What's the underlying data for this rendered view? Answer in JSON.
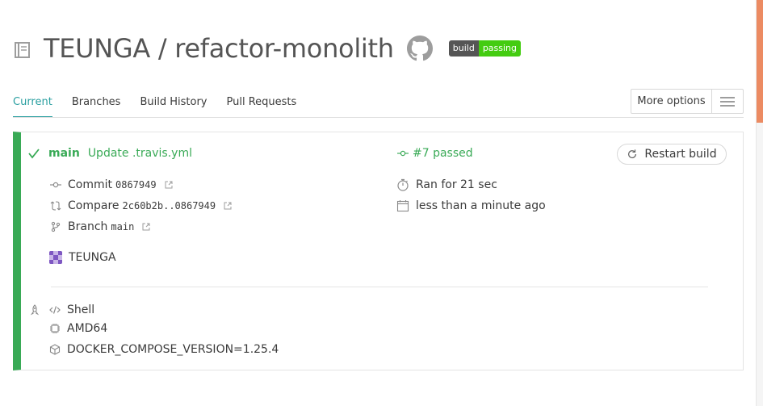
{
  "header": {
    "repo_title": "TEUNGA / refactor-monolith",
    "badge_left": "build",
    "badge_right": "passing"
  },
  "tabs": [
    {
      "label": "Current",
      "active": true
    },
    {
      "label": "Branches",
      "active": false
    },
    {
      "label": "Build History",
      "active": false
    },
    {
      "label": "Pull Requests",
      "active": false
    }
  ],
  "more_options": {
    "label": "More options"
  },
  "build": {
    "branch": "main",
    "commit_message": "Update .travis.yml",
    "status": "#7 passed",
    "restart_label": "Restart build",
    "commit_label": "Commit",
    "commit_sha": "0867949",
    "compare_label": "Compare",
    "compare_range": "2c60b2b..0867949",
    "branch_label": "Branch",
    "branch_value": "main",
    "author": "TEUNGA",
    "duration": "Ran for 21 sec",
    "finished": "less than a minute ago"
  },
  "config": {
    "language": "Shell",
    "arch": "AMD64",
    "env": "DOCKER_COMPOSE_VERSION=1.25.4"
  },
  "colors": {
    "passed": "#39aa56",
    "accent_tab": "#2a9fa0",
    "scroll_accent": "#ec8b62"
  }
}
